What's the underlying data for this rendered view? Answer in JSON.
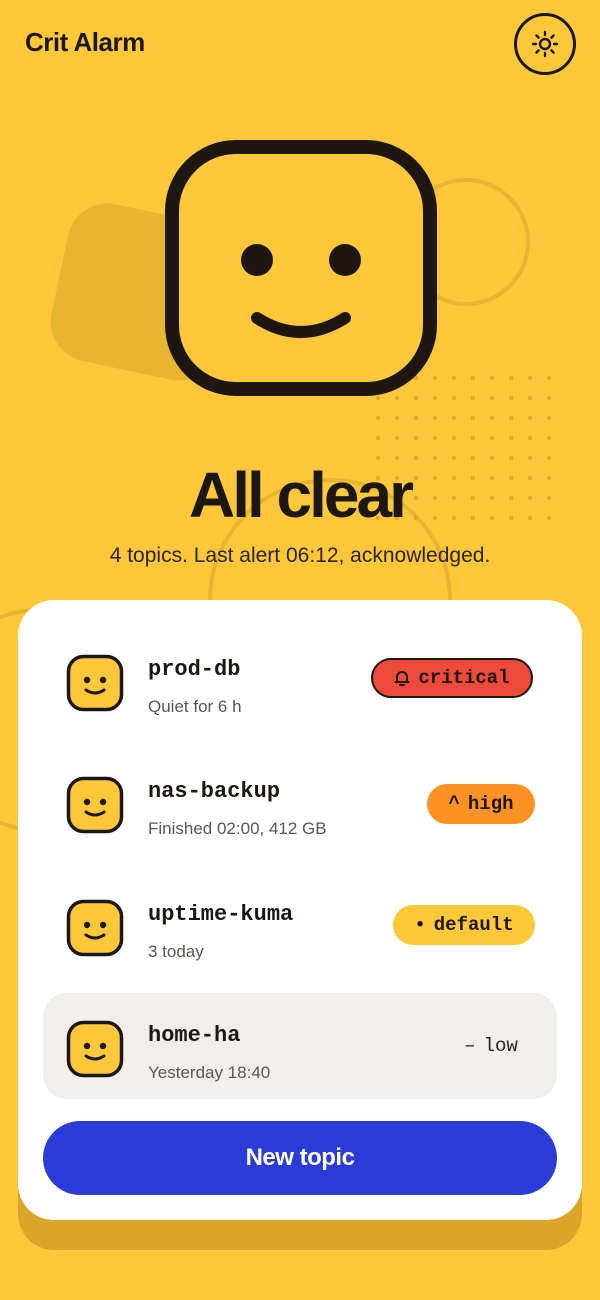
{
  "app": {
    "title": "Crit Alarm",
    "settings_icon": "sun-icon"
  },
  "hero": {
    "icon": "smiley-face-icon",
    "headline": "All clear",
    "subtitle": "4 topics. Last alert 06:12, acknowledged."
  },
  "topics": [
    {
      "name": "prod-db",
      "status": "Quiet for 6 h",
      "priority": "critical",
      "priority_icon": "bell-icon",
      "priority_glyph": ""
    },
    {
      "name": "nas-backup",
      "status": "Finished 02:00, 412 GB",
      "priority": "high",
      "priority_icon": "caret-up-icon",
      "priority_glyph": "^"
    },
    {
      "name": "uptime-kuma",
      "status": "3 today",
      "priority": "default",
      "priority_icon": "dot-icon",
      "priority_glyph": "•"
    },
    {
      "name": "home-ha",
      "status": "Yesterday 18:40",
      "priority": "low",
      "priority_icon": "dash-icon",
      "priority_glyph": "–"
    }
  ],
  "actions": {
    "new_topic_label": "New topic"
  },
  "colors": {
    "background": "#FFC83A",
    "ink": "#1C1710",
    "card": "#FFFFFF",
    "critical": "#EE4A3B",
    "high": "#FF9224",
    "default": "#FFC83A",
    "primary_button": "#2A3BD8",
    "selected_row": "#F1EFEC"
  }
}
